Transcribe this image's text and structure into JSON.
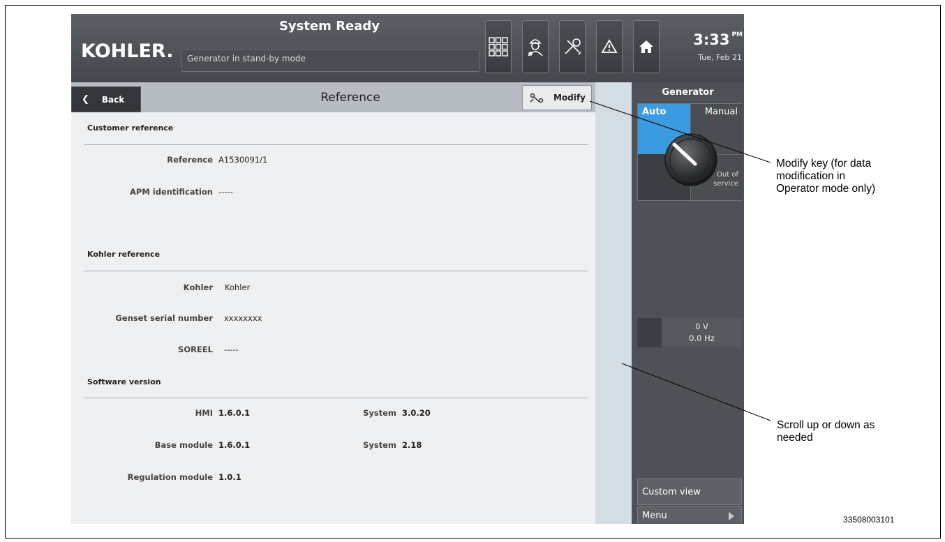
{
  "header": {
    "logo": "KOHLER.",
    "title": "System Ready",
    "status_message": "Generator in stand-by mode",
    "buttons": [
      "grid-apps-icon",
      "operator-icon",
      "tools-icon",
      "alert-icon",
      "home-icon"
    ],
    "clock": {
      "time": "3:33",
      "ampm": "PM",
      "date": "Tue, Feb 21"
    }
  },
  "subbar": {
    "back_label": "Back",
    "page_title": "Reference",
    "modify_label": "Modify"
  },
  "sections": {
    "customer": {
      "title": "Customer reference",
      "rows": [
        {
          "label": "Reference",
          "value": "A1530091/1"
        },
        {
          "label": "APM identification",
          "value": "-----"
        }
      ]
    },
    "kohler": {
      "title": "Kohler reference",
      "rows": [
        {
          "label": "Kohler",
          "value": "Kohler"
        },
        {
          "label": "Genset serial number",
          "value": "xxxxxxxx"
        },
        {
          "label": "SOREEL",
          "value": "-----"
        }
      ]
    },
    "software": {
      "title": "Software version",
      "rows": [
        {
          "label": "HMI",
          "value": "1.6.0.1",
          "label2": "System",
          "value2": "3.0.20"
        },
        {
          "label": "Base module",
          "value": "1.6.0.1",
          "label2": "System",
          "value2": "2.18"
        },
        {
          "label": "Regulation module",
          "value": "1.0.1"
        }
      ]
    }
  },
  "right_panel": {
    "title": "Generator",
    "mode_auto": "Auto",
    "mode_manual": "Manual",
    "mode_oos_line1": "Out of",
    "mode_oos_line2": "service",
    "voltage": "0 V",
    "frequency": "0.0 Hz",
    "custom_view_label": "Custom view",
    "menu_label": "Menu"
  },
  "annotations": {
    "modify_note_l1": "Modify key (for data",
    "modify_note_l2": "modification in",
    "modify_note_l3": "Operator mode only)",
    "scroll_note_l1": "Scroll up or down as",
    "scroll_note_l2": "needed",
    "figure_number": "33508003101"
  },
  "colors": {
    "auto_active": "#3a9be0",
    "header_bg": "#4e5257",
    "content_bg": "#eef0f2"
  }
}
